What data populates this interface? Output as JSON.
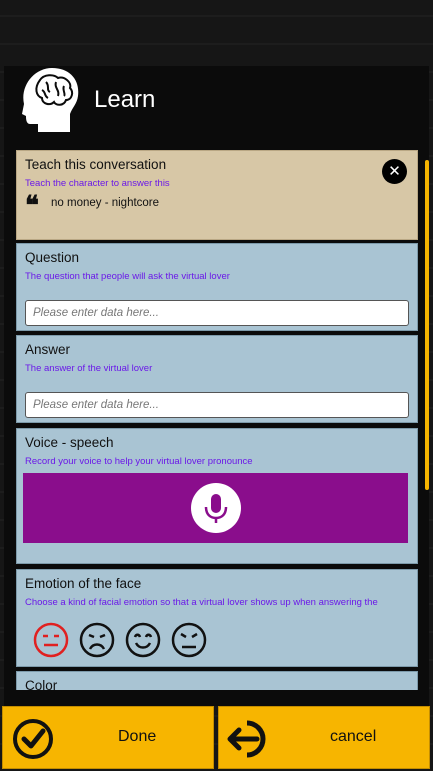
{
  "header": {
    "title": "Learn",
    "icon": "brain-head-icon"
  },
  "teach_card": {
    "title": "Teach this conversation",
    "subtitle": "Teach the character to answer this",
    "quote_icon": "quote-icon",
    "quote_text": "no money - nightcore",
    "close_icon": "close-icon"
  },
  "question_card": {
    "title": "Question",
    "subtitle": "The question that people will ask the virtual lover",
    "input_value": "",
    "input_placeholder": "Please enter data here..."
  },
  "answer_card": {
    "title": "Answer",
    "subtitle": "The answer of the virtual lover",
    "input_value": "",
    "input_placeholder": "Please enter data here..."
  },
  "voice_card": {
    "title": "Voice - speech",
    "subtitle": "Record your voice to help your virtual lover pronounce",
    "mic_icon": "microphone-icon",
    "accent": "#8a0d8c"
  },
  "emotion_card": {
    "title": "Emotion of the face",
    "subtitle": "Choose a kind of facial emotion so that a virtual lover shows up when answering the",
    "options": [
      "neutral-face-icon",
      "sad-face-icon",
      "happy-face-icon",
      "angry-face-icon"
    ],
    "selected": "neutral-face-icon",
    "selected_color": "#e02020"
  },
  "color_card": {
    "title": "Color"
  },
  "footer": {
    "done_label": "Done",
    "done_icon": "checkmark-circle-icon",
    "cancel_label": "cancel",
    "cancel_icon": "exit-arrow-icon",
    "button_color": "#f7b500"
  }
}
